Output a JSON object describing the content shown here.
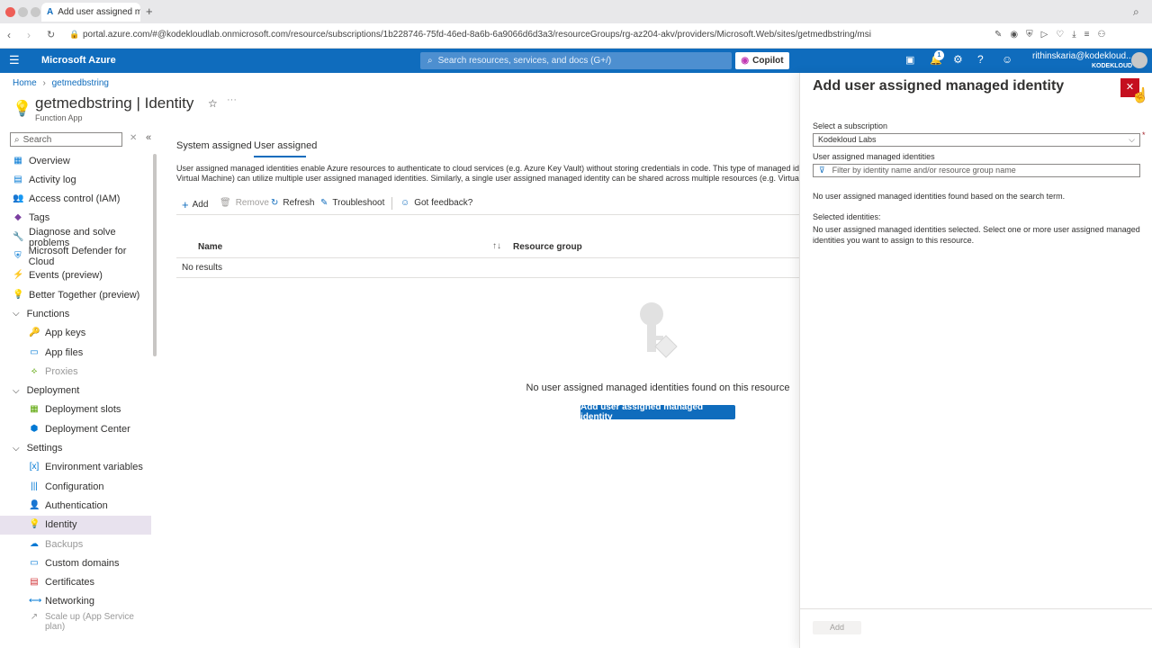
{
  "browser": {
    "tab_title": "Add user assigned man...",
    "url_host": "portal.azure.com",
    "url_path": "/#@kodekloudlab.onmicrosoft.com/resource/subscriptions/1b228746-75fd-46ed-8a6b-6a9066d6d3a3/resourceGroups/rg-az204-akv/providers/Microsoft.Web/sites/getmedbstring/msi"
  },
  "header": {
    "brand": "Microsoft Azure",
    "search_placeholder": "Search resources, services, and docs (G+/)",
    "copilot_label": "Copilot",
    "notification_count": "1",
    "user_email": "rithinskaria@kodekloud...",
    "user_tenant": "KODEKLOUD"
  },
  "breadcrumb": {
    "home": "Home",
    "resource": "getmedbstring"
  },
  "page": {
    "title": "getmedbstring | Identity",
    "subtitle": "Function App"
  },
  "sidebar": {
    "search_placeholder": "Search",
    "items": [
      {
        "label": "Overview",
        "icon": "overview-icon",
        "glyph": "▦",
        "color": "#0078d4"
      },
      {
        "label": "Activity log",
        "icon": "activity-log-icon",
        "glyph": "▤",
        "color": "#0078d4"
      },
      {
        "label": "Access control (IAM)",
        "icon": "iam-icon",
        "glyph": "👥",
        "color": "#0078d4"
      },
      {
        "label": "Tags",
        "icon": "tag-icon",
        "glyph": "◆",
        "color": "#7b3fa0"
      },
      {
        "label": "Diagnose and solve problems",
        "icon": "wrench-icon",
        "glyph": "🔧",
        "color": "#555"
      },
      {
        "label": "Microsoft Defender for Cloud",
        "icon": "shield-icon",
        "glyph": "⛨",
        "color": "#0078d4"
      },
      {
        "label": "Events (preview)",
        "icon": "lightning-icon",
        "glyph": "⚡",
        "color": "#e8a200"
      },
      {
        "label": "Better Together (preview)",
        "icon": "lightbulb-icon",
        "glyph": "💡",
        "color": "#57a300"
      }
    ],
    "groups": {
      "functions": "Functions",
      "deployment": "Deployment",
      "settings": "Settings"
    },
    "functions_items": [
      {
        "label": "App keys",
        "icon": "key-icon",
        "glyph": "🔑",
        "color": "#e8a200"
      },
      {
        "label": "App files",
        "icon": "file-icon",
        "glyph": "▭",
        "color": "#0078d4"
      },
      {
        "label": "Proxies",
        "icon": "proxy-icon",
        "glyph": "⟡",
        "color": "#57a300"
      }
    ],
    "deployment_items": [
      {
        "label": "Deployment slots",
        "icon": "slots-icon",
        "glyph": "▦",
        "color": "#57a300"
      },
      {
        "label": "Deployment Center",
        "icon": "cube-icon",
        "glyph": "⬢",
        "color": "#0078d4"
      }
    ],
    "settings_items": [
      {
        "label": "Environment variables",
        "icon": "variables-icon",
        "glyph": "[x]",
        "color": "#0078d4"
      },
      {
        "label": "Configuration",
        "icon": "config-icon",
        "glyph": "|||",
        "color": "#0078d4"
      },
      {
        "label": "Authentication",
        "icon": "auth-icon",
        "glyph": "👤",
        "color": "#0078d4"
      },
      {
        "label": "Identity",
        "icon": "identity-icon",
        "glyph": "💡",
        "color": "#e8a200"
      },
      {
        "label": "Backups",
        "icon": "backup-icon",
        "glyph": "☁",
        "color": "#0078d4"
      },
      {
        "label": "Custom domains",
        "icon": "domain-icon",
        "glyph": "▭",
        "color": "#0078d4"
      },
      {
        "label": "Certificates",
        "icon": "certificate-icon",
        "glyph": "▤",
        "color": "#d13438"
      },
      {
        "label": "Networking",
        "icon": "network-icon",
        "glyph": "⟷",
        "color": "#0078d4"
      },
      {
        "label": "Scale up (App Service plan)",
        "icon": "scale-icon",
        "glyph": "↗",
        "color": "#999"
      }
    ]
  },
  "tabs": {
    "system": "System assigned",
    "user": "User assigned"
  },
  "description": {
    "line1": "User assigned managed identities enable Azure resources to authenticate to cloud services (e.g. Azure Key Vault) without storing credentials in code. This type of managed identities a",
    "line2": "Virtual Machine) can utilize multiple user assigned managed identities. Similarly, a single user assigned managed identity can be shared across multiple resources (e.g. Virtual Machine"
  },
  "toolbar": {
    "add": "Add",
    "remove": "Remove",
    "refresh": "Refresh",
    "troubleshoot": "Troubleshoot",
    "feedback": "Got feedback?"
  },
  "table": {
    "col_name": "Name",
    "col_rg": "Resource group",
    "no_results": "No results"
  },
  "empty": {
    "message": "No user assigned managed identities found on this resource",
    "button": "Add user assigned managed identity"
  },
  "panel": {
    "title": "Add user assigned managed identity",
    "subscription_label": "Select a subscription",
    "subscription_value": "Kodekloud Labs",
    "identities_label": "User assigned managed identities",
    "filter_placeholder": "Filter by identity name and/or resource group name",
    "no_found": "No user assigned managed identities found based on the search term.",
    "selected_label": "Selected identities:",
    "selected_msg1": "No user assigned managed identities selected. Select one or more user assigned managed",
    "selected_msg2": "identities you want to assign to this resource.",
    "add_button": "Add"
  }
}
